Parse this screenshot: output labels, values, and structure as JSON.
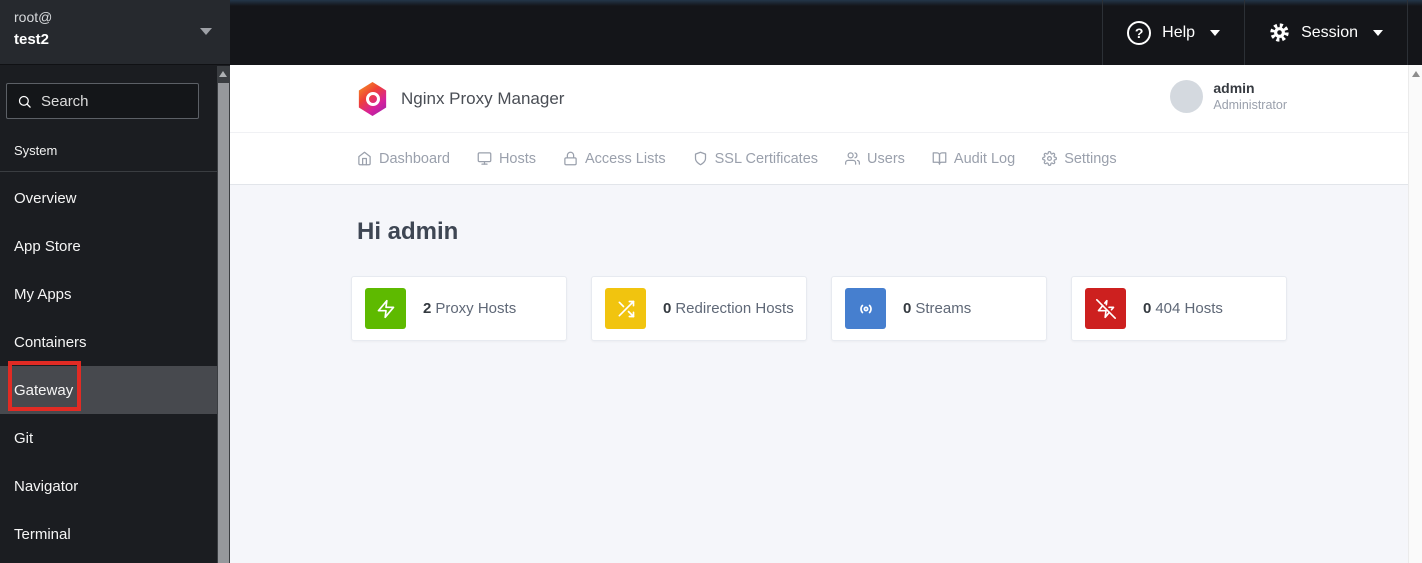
{
  "sidebar_header": {
    "user": "root@",
    "host": "test2"
  },
  "sidebar": {
    "search_placeholder": "Search",
    "section": "System",
    "items": [
      {
        "label": "Overview",
        "active": false
      },
      {
        "label": "App Store",
        "active": false
      },
      {
        "label": "My Apps",
        "active": false
      },
      {
        "label": "Containers",
        "active": false
      },
      {
        "label": "Gateway",
        "active": true
      },
      {
        "label": "Git",
        "active": false
      },
      {
        "label": "Navigator",
        "active": false
      },
      {
        "label": "Terminal",
        "active": false
      }
    ]
  },
  "masthead": {
    "help": "Help",
    "session": "Session"
  },
  "app": {
    "title": "Nginx Proxy Manager",
    "user": {
      "name": "admin",
      "role": "Administrator"
    },
    "tabs": [
      {
        "label": "Dashboard",
        "icon": "home"
      },
      {
        "label": "Hosts",
        "icon": "monitor"
      },
      {
        "label": "Access Lists",
        "icon": "lock"
      },
      {
        "label": "SSL Certificates",
        "icon": "shield"
      },
      {
        "label": "Users",
        "icon": "users"
      },
      {
        "label": "Audit Log",
        "icon": "book-open"
      },
      {
        "label": "Settings",
        "icon": "gear"
      }
    ],
    "greeting": "Hi admin",
    "cards": [
      {
        "count": "2",
        "label": "Proxy Hosts",
        "icon": "zap",
        "color": "#5eba00"
      },
      {
        "count": "0",
        "label": "Redirection Hosts",
        "icon": "shuffle",
        "color": "#f1c40f"
      },
      {
        "count": "0",
        "label": "Streams",
        "icon": "radio",
        "color": "#467fcf"
      },
      {
        "count": "0",
        "label": "404 Hosts",
        "icon": "zap-off",
        "color": "#cd201f"
      }
    ]
  },
  "annotation": {
    "highlight_target": "Gateway",
    "color": "#e12b24"
  }
}
